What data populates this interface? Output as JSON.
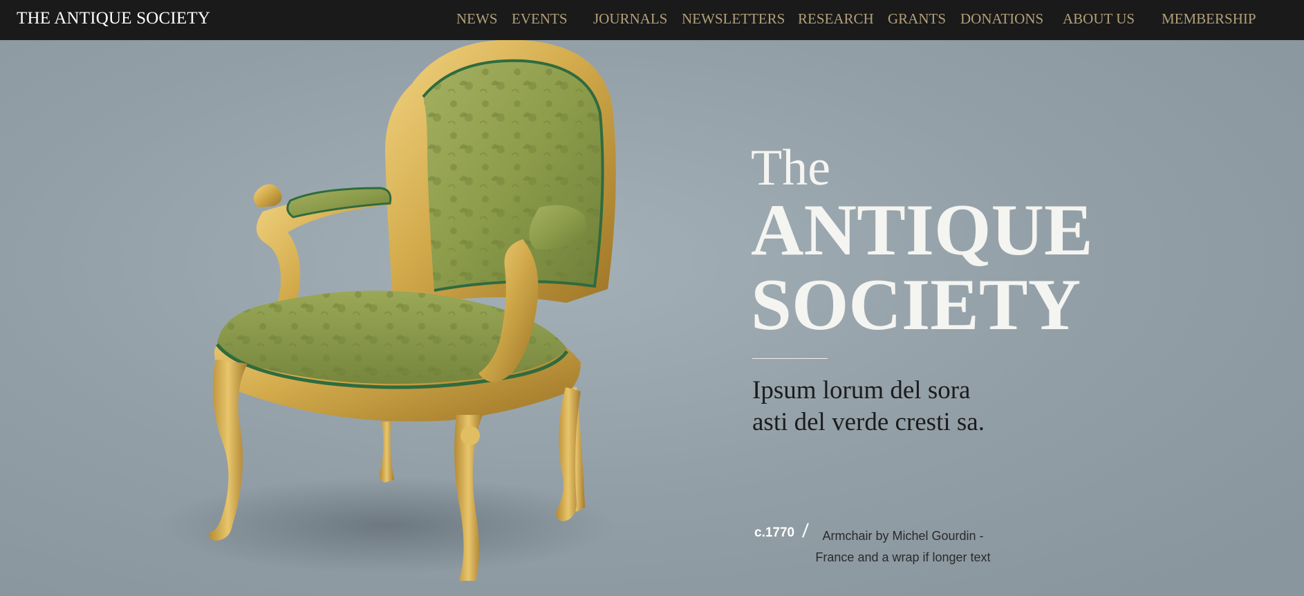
{
  "header": {
    "brand": "THE ANTIQUE SOCIETY",
    "nav": [
      "NEWS",
      "EVENTS",
      "JOURNALS",
      "NEWSLETTERS",
      "RESEARCH",
      "GRANTS",
      "DONATIONS",
      "ABOUT US",
      "MEMBERSHIP"
    ]
  },
  "hero": {
    "the": "The",
    "title_lines": [
      "ANTIQUE",
      "SOCIETY"
    ],
    "tagline_lines": [
      "Ipsum lorum del sora",
      "asti del verde cresti sa."
    ],
    "image_icon": "armchair-photo"
  },
  "caption": {
    "year": "c.1770",
    "slash": "/",
    "text": "Armchair by Michel Gourdin - France and a wrap if longer text"
  },
  "colors": {
    "background": "#919fa7",
    "topbar": "#1a1a1a",
    "nav_text": "#b3a07a",
    "upholstery": "#8a9a4c",
    "gilt": "#d2ad50"
  }
}
